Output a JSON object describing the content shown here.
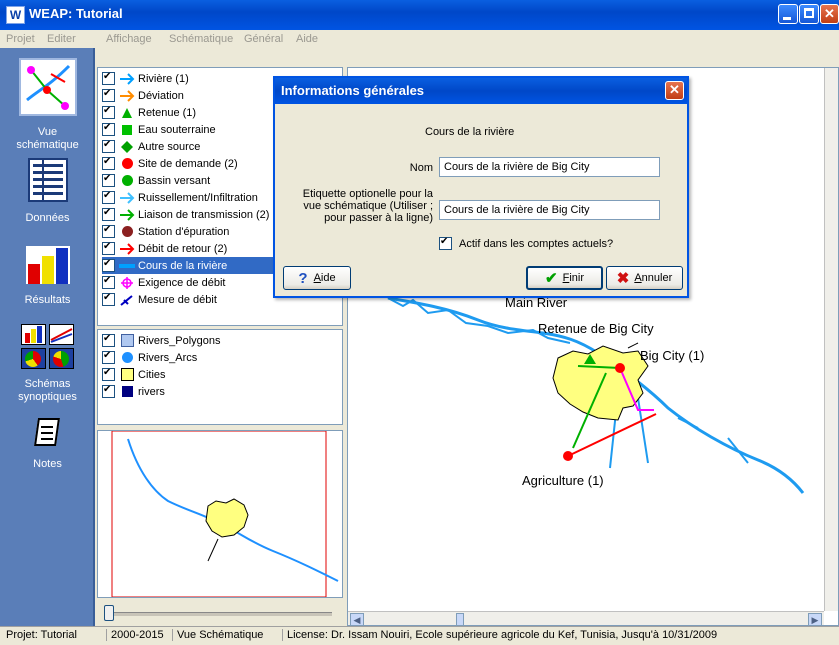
{
  "window": {
    "app_icon": "W",
    "title": "WEAP: Tutorial",
    "buttons": [
      "minimize-icon",
      "maximize-icon",
      "close-icon"
    ]
  },
  "menu": [
    "Projet",
    "Editer",
    "Affichage",
    "Schématique",
    "Général",
    "Aide"
  ],
  "nav": [
    {
      "label_line1": "Vue",
      "label_line2": "schématique",
      "icon": "schematic-view-icon"
    },
    {
      "label_line1": "Données",
      "label_line2": "",
      "icon": "data-icon"
    },
    {
      "label_line1": "Résultats",
      "label_line2": "",
      "icon": "results-icon"
    },
    {
      "label_line1": "Schémas",
      "label_line2": "synoptiques",
      "icon": "overviews-icon"
    },
    {
      "label_line1": "Notes",
      "label_line2": "",
      "icon": "notes-icon"
    }
  ],
  "legend": [
    {
      "label": "Rivière (1)",
      "icon": "river-arrow-icon",
      "color": "#00A0FF"
    },
    {
      "label": "Déviation",
      "icon": "diversion-arrow-icon",
      "color": "#FF8C00"
    },
    {
      "label": "Retenue (1)",
      "icon": "reservoir-triangle-icon",
      "color": "#00B000"
    },
    {
      "label": "Eau souterraine",
      "icon": "groundwater-square-icon",
      "color": "#00C000"
    },
    {
      "label": "Autre source",
      "icon": "other-source-diamond-icon",
      "color": "#00A000"
    },
    {
      "label": "Site de demande (2)",
      "icon": "demand-site-dot-icon",
      "color": "#FF0000"
    },
    {
      "label": "Bassin versant",
      "icon": "catchment-dot-icon",
      "color": "#00B000"
    },
    {
      "label": "Ruissellement/Infiltration",
      "icon": "runoff-arrow-icon",
      "color": "#40C0FF"
    },
    {
      "label": "Liaison de transmission (2)",
      "icon": "transmission-arrow-icon",
      "color": "#00B000"
    },
    {
      "label": "Station d'épuration",
      "icon": "treatment-dot-icon",
      "color": "#8B2020"
    },
    {
      "label": "Débit de retour (2)",
      "icon": "return-flow-arrow-icon",
      "color": "#FF0000"
    },
    {
      "label": "Cours de la rivière",
      "icon": "river-reach-line-icon",
      "color": "#00A0FF"
    },
    {
      "label": "Exigence de débit",
      "icon": "flow-requirement-icon",
      "color": "#FF00FF"
    },
    {
      "label": "Mesure de débit",
      "icon": "streamflow-gauge-icon",
      "color": "#0000C0"
    }
  ],
  "layers": [
    {
      "label": "Rivers_Polygons",
      "icon": "polygon-layer-icon",
      "color": "#B0C8F0"
    },
    {
      "label": "Rivers_Arcs",
      "icon": "arc-layer-icon",
      "color": "#1E90FF"
    },
    {
      "label": "Cities",
      "icon": "cities-layer-icon",
      "color": "#FFFF80"
    },
    {
      "label": "rivers",
      "icon": "rivers-layer-icon",
      "color": "#000080"
    }
  ],
  "map": {
    "labels": {
      "main_river": "Main River",
      "reservoir": "Retenue de Big City",
      "city": "Big City (1)",
      "agriculture": "Agriculture (1)"
    }
  },
  "dialog": {
    "title": "Informations générales",
    "heading": "Cours de la rivière",
    "name_label": "Nom",
    "name_value": "Cours de la rivière de Big City",
    "label_line1": "Etiquette optionelle pour la",
    "label_line2": "vue schématique (Utiliser ;",
    "label_line3": "pour passer à la ligne)",
    "label_value": "Cours de la rivière de Big City",
    "active_label": "Actif dans les comptes actuels?",
    "active_checked": true,
    "help_accel": "A",
    "help_rest": "ide",
    "finish_accel": "F",
    "finish_rest": "inir",
    "cancel_accel": "A",
    "cancel_rest": "nnuler"
  },
  "status": [
    "Projet: Tutorial",
    "2000-2015",
    "Vue Schématique",
    "License: Dr. Issam Nouiri, Ecole supérieure agricole du Kef, Tunisia, Jusqu'à 10/31/2009"
  ]
}
